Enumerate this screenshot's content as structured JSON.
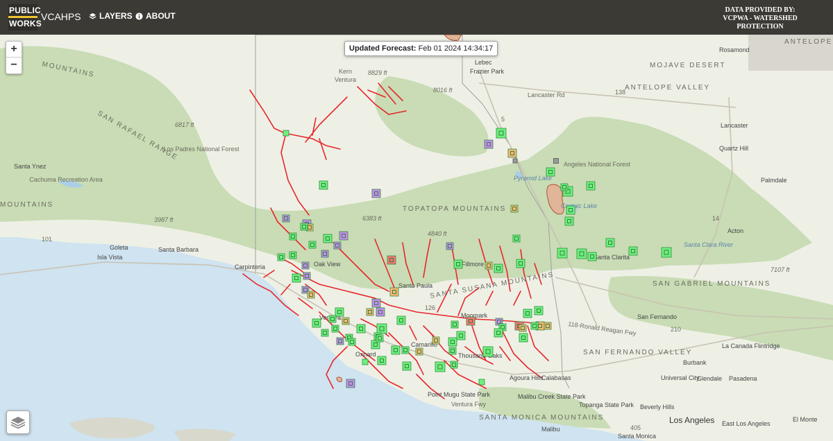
{
  "header": {
    "logo_line1": "PUBLIC",
    "logo_line2": "WORKS",
    "app_title": "VCAHPS",
    "nav_layers": "LAYERS",
    "nav_about": "ABOUT",
    "provider_line1": "DATA PROVIDED BY:",
    "provider_line2": "VCPWA - WATERSHED",
    "provider_line3": "PROTECTION"
  },
  "forecast": {
    "label": "Updated Forecast:",
    "timestamp": "Feb 01 2024 14:34:17"
  },
  "controls": {
    "zoom_in": "+",
    "zoom_out": "−"
  },
  "colors": {
    "water": "#cfe3f0",
    "land": "#eef0e6",
    "forest": "#c9dcb5",
    "stream": "#e8262a",
    "status_green": "#6fef7f",
    "status_purple": "#c78cf0",
    "status_orange": "#f7b877",
    "status_red": "#f47575"
  },
  "map_labels": {
    "mountains": [
      "MOUNTAINS",
      "SAN RAFAEL RANGE",
      "TOPATOPA MOUNTAINS",
      "SANTA SUSANA MOUNTAINS",
      "SAN GABRIEL MOUNTAINS",
      "SANTA MONICA MOUNTAINS",
      "MOUNTAINS"
    ],
    "regions": [
      "MOJAVE DESERT",
      "ANTELOPE VALLEY",
      "SAN FERNANDO VALLEY",
      "ANTELOPE"
    ],
    "forests": [
      "Los Padres National Forest",
      "Angeles National Forest",
      "Cachuma Recreation Area"
    ],
    "cities": [
      "Frazier Park",
      "Lebec",
      "Rosamond",
      "Lancaster",
      "Quartz Hill",
      "Palmdale",
      "Acton",
      "Santa Ynez",
      "Goleta",
      "Isla Vista",
      "Santa Barbara",
      "Carpinteria",
      "Oak View",
      "Santa Paula",
      "Ventura",
      "Oxnard",
      "Camarillo",
      "Thousand Oaks",
      "Moorpark",
      "Fillmore",
      "Agoura Hills",
      "Calabasas",
      "San Fernando",
      "Burbank",
      "Glendale",
      "Pasadena",
      "La Canada Flintridge",
      "Universal City",
      "Beverly Hills",
      "Los Angeles",
      "East Los Angeles",
      "El Monte",
      "Malibu",
      "Point Mugu State Park",
      "Malibu Creek State Park",
      "Topanga State Park",
      "Santa Monica",
      "Santa Clarita",
      "Lancaster Rd",
      "Kern",
      "Ventura"
    ],
    "elevations": [
      "8829 ft",
      "8016 ft",
      "6817 ft",
      "6383 ft",
      "4840 ft",
      "3987 ft",
      "7107 ft"
    ],
    "roads": [
      "138",
      "118-Ronald Reagan Fwy",
      "210",
      "101",
      "405",
      "5",
      "14",
      "126",
      "Ventura Fwy"
    ],
    "waters": [
      "Santa Clara River",
      "Castaic Lake",
      "Pyramid Lake"
    ]
  },
  "stations": {
    "green": 62,
    "purple": 14,
    "orange": 9,
    "red": 3
  }
}
